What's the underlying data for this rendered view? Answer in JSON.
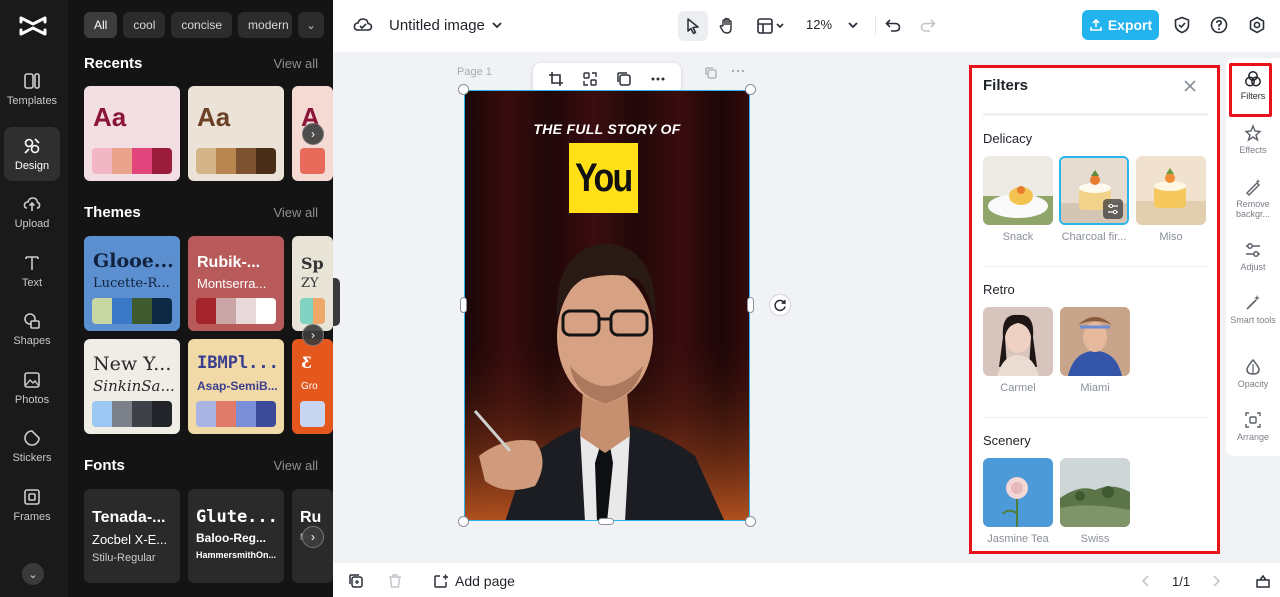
{
  "left_rail": {
    "items": [
      {
        "label": "Templates",
        "icon": "templates-icon"
      },
      {
        "label": "Design",
        "icon": "design-icon",
        "active": true
      },
      {
        "label": "Upload",
        "icon": "upload-icon"
      },
      {
        "label": "Text",
        "icon": "text-icon"
      },
      {
        "label": "Shapes",
        "icon": "shapes-icon"
      },
      {
        "label": "Photos",
        "icon": "photos-icon"
      },
      {
        "label": "Stickers",
        "icon": "stickers-icon"
      },
      {
        "label": "Frames",
        "icon": "frames-icon"
      }
    ]
  },
  "design_panel": {
    "chips": [
      "All",
      "cool",
      "concise",
      "modern"
    ],
    "recents": {
      "title": "Recents",
      "view_all": "View all",
      "cards": [
        {
          "sample": "Aa",
          "bg": "#f3dfe3",
          "text_color": "#8a1538",
          "colors": [
            "#f2b7c4",
            "#e8a38a",
            "#e0457b",
            "#9b1d3e"
          ]
        },
        {
          "sample": "Aa",
          "bg": "#ece3d8",
          "text_color": "#6b4226",
          "colors": [
            "#d6b48a",
            "#b8864f",
            "#7d5230",
            "#4a2e1a"
          ]
        },
        {
          "sample": "A",
          "bg": "#f5d9d3",
          "text_color": "#8a1538",
          "colors": [
            "#e86a5b"
          ]
        }
      ]
    },
    "themes": {
      "title": "Themes",
      "view_all": "View all",
      "cards": [
        {
          "title": "Glooe...",
          "subtitle": "Lucette-R...",
          "bg": "#5b8fd0",
          "fg": "#10223d",
          "colors": [
            "#c7d6a3",
            "#3a78c8",
            "#3f5a2f",
            "#0f2944"
          ]
        },
        {
          "title": "Rubik-...",
          "subtitle": "Montserra...",
          "bg": "#b85a5a",
          "fg": "#ffffff",
          "colors": [
            "#a4252c",
            "#c9a5a6",
            "#e8d9da",
            "#ffffff"
          ]
        },
        {
          "title": "Sp",
          "subtitle": "ZY",
          "bg": "#e9e4d8",
          "fg": "#333333",
          "colors": [
            "#7fd3c0",
            "#f0a86a"
          ]
        },
        {
          "title": "New Y...",
          "subtitle": "SinkinSa...",
          "bg": "#f0ece6",
          "fg": "#2a2a2a",
          "colors": [
            "#9cc7f2",
            "#7b8089",
            "#3e4148",
            "#22242a"
          ]
        },
        {
          "title": "IBMPl...",
          "subtitle": "Asap-SemiB...",
          "bg": "#f1d9a8",
          "fg": "#3a3f8f",
          "colors": [
            "#a9b4e2",
            "#e07b6a",
            "#7b8fd8",
            "#3d4a99"
          ]
        },
        {
          "title": "Ƹ",
          "subtitle": "Gro",
          "bg": "#e4571d",
          "fg": "#ffffff",
          "colors": [
            "#c9d6f2"
          ]
        }
      ]
    },
    "fonts": {
      "title": "Fonts",
      "view_all": "View all",
      "cards": [
        {
          "line1": "Tenada-...",
          "line2": "Zocbel X-E...",
          "line3": "Stilu-Regular"
        },
        {
          "line1": "Glute...",
          "line2": "Baloo-Reg...",
          "line3": "HammersmithOn..."
        },
        {
          "line1": "Ru",
          "line2": "",
          "line3": "Mon"
        }
      ]
    }
  },
  "topbar": {
    "title": "Untitled image",
    "zoom": "12%",
    "export_label": "Export"
  },
  "canvas": {
    "page_label": "Page 1",
    "headline": "THE FULL STORY OF",
    "big_word": "You"
  },
  "filters": {
    "title": "Filters",
    "categories": [
      {
        "name": "Delicacy",
        "items": [
          {
            "label": "Snack",
            "selected": false
          },
          {
            "label": "Charcoal fir...",
            "selected": true
          },
          {
            "label": "Miso",
            "selected": false
          }
        ]
      },
      {
        "name": "Retro",
        "items": [
          {
            "label": "Carmel",
            "selected": false
          },
          {
            "label": "Miami",
            "selected": false
          }
        ]
      },
      {
        "name": "Scenery",
        "items": [
          {
            "label": "Jasmine Tea",
            "selected": false
          },
          {
            "label": "Swiss",
            "selected": false
          }
        ]
      }
    ]
  },
  "right_rail": {
    "items": [
      {
        "label": "Filters",
        "icon": "filters-icon",
        "active": true
      },
      {
        "label": "Effects",
        "icon": "effects-icon"
      },
      {
        "label": "Remove backgr...",
        "icon": "remove-background-icon"
      },
      {
        "label": "Adjust",
        "icon": "adjust-icon"
      },
      {
        "label": "Smart tools",
        "icon": "smart-tools-icon"
      },
      {
        "label": "Opacity",
        "icon": "opacity-icon"
      },
      {
        "label": "Arrange",
        "icon": "arrange-icon"
      }
    ]
  },
  "bottombar": {
    "add_page_label": "Add page",
    "page_indicator": "1/1"
  },
  "colors": {
    "accent": "#23b3ee",
    "highlight_box": "#e8121b",
    "you_box": "#ffe017"
  }
}
